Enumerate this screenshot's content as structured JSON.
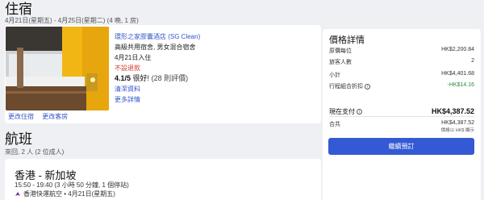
{
  "stay": {
    "title": "住宿",
    "dates": "4月21日(星期五) - 4月25日(星期二) (4 晚, 1 房)",
    "hotel_name": "環形之家膠囊酒店 (SG Clean)",
    "room_type": "高級共用宿舍, 男女混合宿舍",
    "checkin": "4月21日入住",
    "refund": "不設退款",
    "rating_score": "4.1/5",
    "rating_word": "很好!",
    "rating_count": "(28 則評價)",
    "policy_link": "清潔資料",
    "more_link": "更多詳情",
    "change_stay": "更改住宿",
    "change_room": "更改客房"
  },
  "flight": {
    "title": "航班",
    "sub": "來回, 2 人 (2 位成人)",
    "route": "香港 - 新加坡",
    "time": "15:50 - 19:40 (3 小時 50 分鐘, 1 個停站)",
    "airline": "香港快運航空 • 4月21日(星期五)"
  },
  "price": {
    "title": "價格詳情",
    "rows": [
      {
        "label": "原價每位",
        "value": "HK$2,200.84"
      },
      {
        "label": "旅客人數",
        "value": "2"
      },
      {
        "label": "小計",
        "value": "HK$4,401.68"
      },
      {
        "label": "行程組合折扣",
        "value": "-HK$14.16"
      }
    ],
    "pay_now_label": "現在支付",
    "pay_now_value": "HK$4,387.52",
    "total_label": "合共",
    "total_value": "HK$4,387.52",
    "total_note": "價格以 HK$ 顯示",
    "cta": "繼續預訂"
  },
  "colors": {
    "accent": "#3459d4",
    "link": "#3457c8",
    "refund": "#d63a2a",
    "discount": "#2b8a3e"
  },
  "icons": {
    "info": "info-icon",
    "airline": "airline-logo-icon"
  }
}
